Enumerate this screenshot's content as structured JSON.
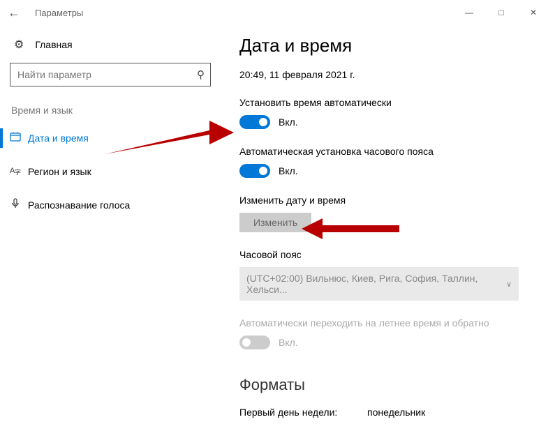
{
  "titlebar": {
    "title": "Параметры"
  },
  "home_label": "Главная",
  "search": {
    "placeholder": "Найти параметр"
  },
  "section_label": "Время и язык",
  "nav": {
    "items": [
      {
        "label": "Дата и время"
      },
      {
        "label": "Регион и язык"
      },
      {
        "label": "Распознавание голоса"
      }
    ]
  },
  "page_title": "Дата и время",
  "current_datetime": "20:49, 11 февраля 2021 г.",
  "auto_time": {
    "label": "Установить время автоматически",
    "state": "Вкл."
  },
  "auto_tz": {
    "label": "Автоматическая установка часового пояса",
    "state": "Вкл."
  },
  "change_dt": {
    "label": "Изменить дату и время",
    "button": "Изменить"
  },
  "timezone": {
    "label": "Часовой пояс",
    "value": "(UTC+02:00) Вильнюс, Киев, Рига, София, Таллин, Хельси..."
  },
  "dst": {
    "label": "Автоматически переходить на летнее время и обратно",
    "state": "Вкл."
  },
  "formats": {
    "title": "Форматы",
    "first_day_label": "Первый день недели:",
    "first_day_value": "понедельник"
  }
}
